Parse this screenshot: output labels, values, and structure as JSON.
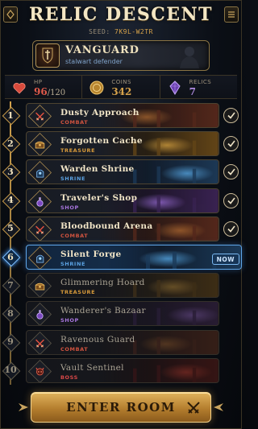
{
  "header": {
    "title": "RELIC DESCENT",
    "seed_label": "SEED:",
    "seed_value": "7K9L-W2TR"
  },
  "player": {
    "class_name": "VANGUARD",
    "class_subtitle": "stalwart defender"
  },
  "stats": {
    "hp": {
      "label": "HP",
      "current": "96",
      "max": "/120",
      "icon": "heart-icon"
    },
    "coins": {
      "label": "COINS",
      "value": "342",
      "icon": "coin-icon"
    },
    "relics": {
      "label": "RELICS",
      "value": "7",
      "icon": "crystal-icon"
    }
  },
  "rooms": [
    {
      "num": "1",
      "name": "Dusty Approach",
      "type": "COMBAT",
      "icon": "crossed-swords-icon",
      "status": "cleared"
    },
    {
      "num": "2",
      "name": "Forgotten Cache",
      "type": "TREASURE",
      "icon": "chest-icon",
      "status": "cleared"
    },
    {
      "num": "3",
      "name": "Warden Shrine",
      "type": "SHRINE",
      "icon": "shrine-icon",
      "status": "cleared"
    },
    {
      "num": "4",
      "name": "Traveler's Shop",
      "type": "SHOP",
      "icon": "potion-icon",
      "status": "cleared"
    },
    {
      "num": "5",
      "name": "Bloodbound Arena",
      "type": "COMBAT",
      "icon": "crossed-swords-icon",
      "status": "cleared"
    },
    {
      "num": "6",
      "name": "Silent Forge",
      "type": "SHRINE",
      "icon": "shrine-icon",
      "status": "current"
    },
    {
      "num": "7",
      "name": "Glimmering Hoard",
      "type": "TREASURE",
      "icon": "chest-icon",
      "status": "locked"
    },
    {
      "num": "8",
      "name": "Wanderer's Bazaar",
      "type": "SHOP",
      "icon": "potion-icon",
      "status": "locked"
    },
    {
      "num": "9",
      "name": "Ravenous Guard",
      "type": "COMBAT",
      "icon": "crossed-swords-icon",
      "status": "locked"
    },
    {
      "num": "10",
      "name": "Vault Sentinel",
      "type": "BOSS",
      "icon": "demon-skull-icon",
      "status": "locked"
    }
  ],
  "current_badge": "NOW",
  "type_colors": {
    "COMBAT": "#d0533f",
    "TREASURE": "#d79a3a",
    "SHRINE": "#5aa0e0",
    "SHOP": "#a775dd",
    "BOSS": "#d94848"
  },
  "enter_button": {
    "label": "ENTER ROOM",
    "icon": "crossed-swords-icon"
  },
  "colors": {
    "accent_gold": "#d6a24a",
    "current_blue": "#5fa6e8",
    "hp_red": "#e05a4a"
  }
}
